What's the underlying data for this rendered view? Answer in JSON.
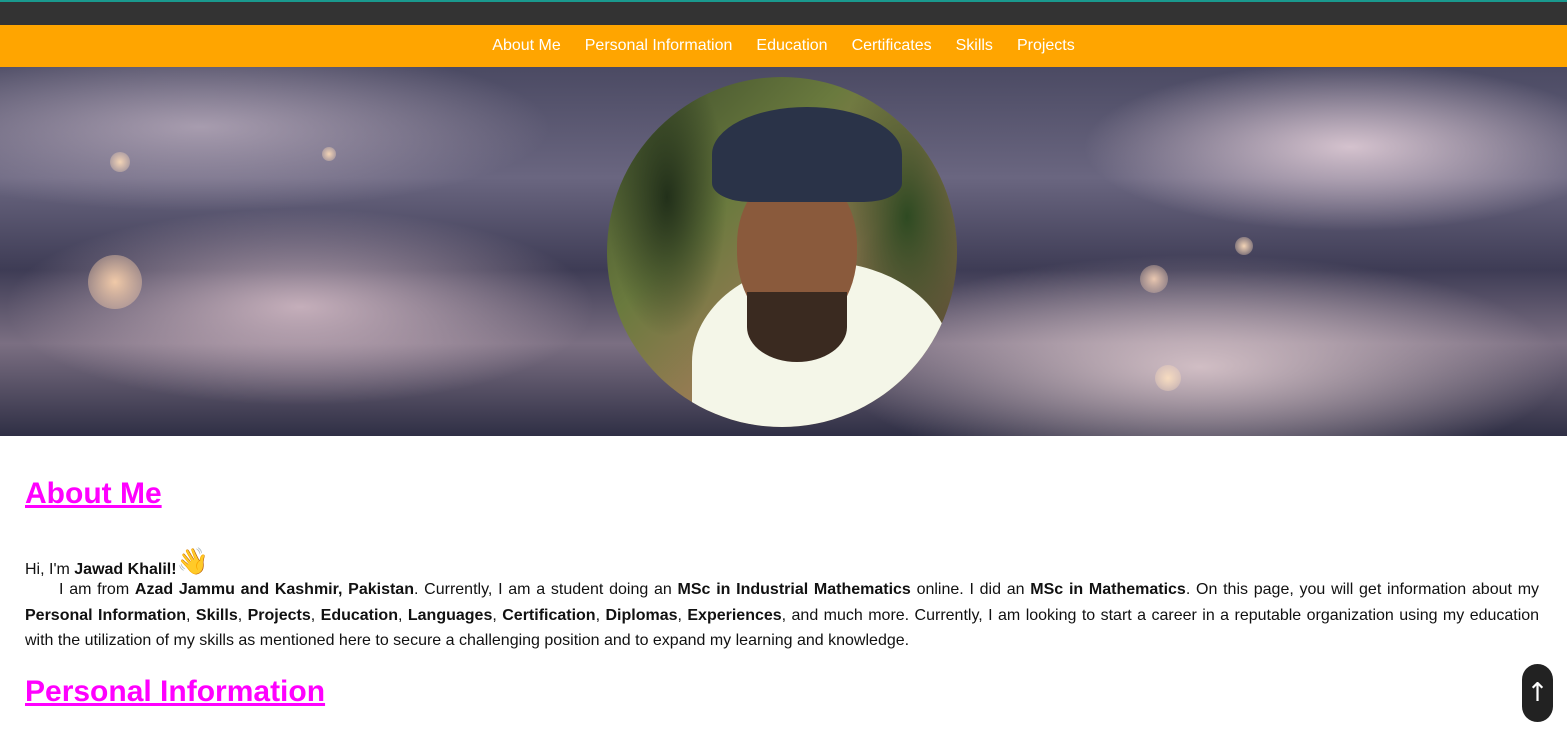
{
  "nav": {
    "items": [
      {
        "label": "About Me"
      },
      {
        "label": "Personal Information"
      },
      {
        "label": "Education"
      },
      {
        "label": "Certificates"
      },
      {
        "label": "Skills"
      },
      {
        "label": "Projects"
      }
    ]
  },
  "about": {
    "title": "About Me",
    "greeting_prefix": "Hi, I'm ",
    "name": "Jawad Khalil!",
    "wave_icon": "👋",
    "p": {
      "t1": "I am from ",
      "b1": "Azad Jammu and Kashmir, Pakistan",
      "t2": ". Currently, I am a student doing an ",
      "b2": "MSc in Industrial Mathematics",
      "t3": " online. I did an ",
      "b3": "MSc in Mathematics",
      "t4": ". On this page, you will get information about my ",
      "b4": "Personal Information",
      "s1": ", ",
      "b5": "Skills",
      "s2": ", ",
      "b6": "Projects",
      "s3": ", ",
      "b7": "Education",
      "s4": ", ",
      "b8": "Languages",
      "s5": ", ",
      "b9": "Certification",
      "s6": ", ",
      "b10": "Diplomas",
      "s7": ", ",
      "b11": "Experiences",
      "t5": ", and much more. Currently, I am looking to start a career in a reputable organization using my education with the utilization of my skills as mentioned here to secure a challenging position and to expand my learning and knowledge."
    }
  },
  "personal": {
    "title": "Personal Information"
  },
  "back_to_top": {
    "icon": "↑"
  },
  "colors": {
    "nav_bg": "#ffa500",
    "heading": "#ff00ff",
    "topbar": "#333333"
  }
}
